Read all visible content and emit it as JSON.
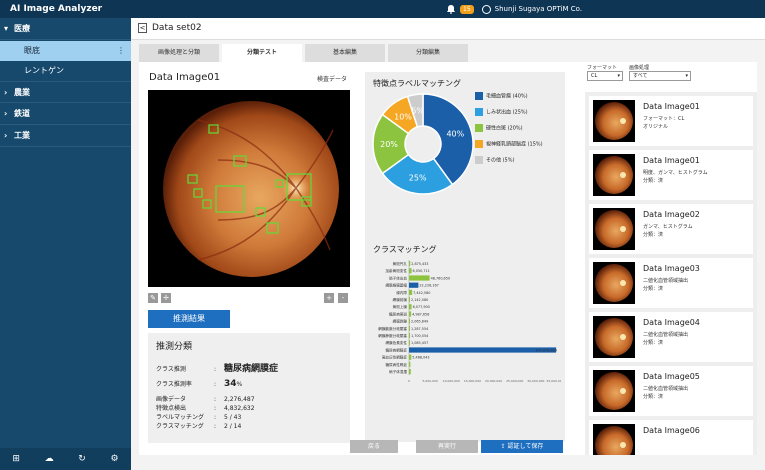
{
  "app": {
    "title": "AI Image Analyzer",
    "notification_count": "15",
    "user": "Shunji Sugaya OPTiM Co."
  },
  "sidebar": {
    "categories": [
      {
        "label": "医療",
        "expanded": true,
        "items": [
          {
            "label": "眼底",
            "active": true
          },
          {
            "label": "レントゲン",
            "active": false
          }
        ]
      },
      {
        "label": "農業",
        "expanded": false
      },
      {
        "label": "鉄道",
        "expanded": false
      },
      {
        "label": "工業",
        "expanded": false
      }
    ],
    "kebab": "⋮"
  },
  "header": {
    "back": "<",
    "dataset": "Data set02"
  },
  "tabs": [
    {
      "label": "画像処理と分類",
      "active": false
    },
    {
      "label": "分類テスト",
      "active": true
    },
    {
      "label": "基本編集",
      "active": false
    },
    {
      "label": "分類編集",
      "active": false
    }
  ],
  "image_panel": {
    "title": "Data Image01",
    "inspect_link": "検査データ",
    "result_button": "推測結果",
    "plus": "+",
    "minus": "-"
  },
  "inference": {
    "title": "推測分類",
    "rows": [
      {
        "k": "クラス推測",
        "v": "糖尿病網膜症"
      },
      {
        "k": "クラス推測率",
        "v": "34",
        "unit": "%"
      },
      {
        "k": "画像データ",
        "v": "2,276,487"
      },
      {
        "k": "特徴点検出",
        "v": "4,832,632"
      },
      {
        "k": "ラベルマッチング",
        "v": "5 / 43"
      },
      {
        "k": "クラスマッチング",
        "v": "2 / 14"
      }
    ]
  },
  "chart_titles": {
    "pie": "特徴点ラベルマッチング",
    "bar": "クラスマッチング"
  },
  "chart_data": [
    {
      "type": "pie",
      "title": "特徴点ラベルマッチング",
      "legend_position": "right",
      "categories": [
        "毛細血管瘤 (40%)",
        "しみ状出血 (25%)",
        "硬性白斑 (20%)",
        "視神経乳頭部脳症 (15%)",
        "その他 (5%)"
      ],
      "labels": [
        "40%",
        "25%",
        "20%",
        "10%",
        "5%"
      ],
      "values": [
        40,
        25,
        20,
        10,
        5
      ],
      "colors": [
        "#1a5fa8",
        "#2b9fe0",
        "#8cc43f",
        "#f5a623",
        "#cccccc"
      ]
    },
    {
      "type": "bar",
      "title": "クラスマッチング",
      "orientation": "horizontal",
      "categories": [
        "黄斑円孔",
        "加齢黄斑変性",
        "硝子体出血",
        "網脈絡膜萎縮",
        "緑内障",
        "網膜前膜",
        "黄斑上膜",
        "糖尿病黄斑",
        "網膜剥離",
        "網膜動脈分岐閉塞",
        "網膜静脈分岐閉塞",
        "網膜色素変性",
        "糖尿病網膜症",
        "高血圧性網膜症",
        "糖尿病性腎症",
        "硝子体混濁"
      ],
      "values": [
        2875433,
        6050711,
        48760659,
        22226167,
        7442580,
        2142580,
        6077900,
        4987658,
        2065649,
        1287554,
        1700554,
        1085457,
        347876659,
        5468043,
        3210000,
        4200000
      ],
      "value_labels": [
        "2,875,433",
        "6,050,711",
        "48,760,659",
        "22,226,167",
        "7,442,580",
        "2,142,580",
        "6,077,900",
        "4,987,658",
        "2,065,649",
        "1,287,554",
        "1,700,554",
        "1,085,457",
        "347,876,659",
        "5,468,043",
        "",
        ""
      ],
      "highlight_index": [
        3,
        12
      ],
      "xlim": [
        0,
        350000000
      ],
      "xticks": [
        "0",
        "5,000,000",
        "10,000,000",
        "15,000,000",
        "20,000,000",
        "25,000,000",
        "30,000,000",
        "35,000,000"
      ],
      "colors": {
        "normal": "#8cc43f",
        "highlight": "#1a5fa8"
      }
    }
  ],
  "filters": {
    "format_label": "フォーマット",
    "format_value": "CL",
    "process_label": "画像処理",
    "process_value": "すべて"
  },
  "list": [
    {
      "name": "Data Image01",
      "l1": "フォーマット：CL",
      "l2": "オリジナル"
    },
    {
      "name": "Data Image01",
      "l1": "明度、ガンマ、ヒストグラム",
      "l2": "分類：済"
    },
    {
      "name": "Data Image02",
      "l1": "ガンマ、ヒストグラム",
      "l2": "分類：済"
    },
    {
      "name": "Data Image03",
      "l1": "二値化血管領域抽出",
      "l2": "分類：済"
    },
    {
      "name": "Data Image04",
      "l1": "二値化血管領域抽出",
      "l2": "分類：済"
    },
    {
      "name": "Data Image05",
      "l1": "二値化血管領域抽出",
      "l2": "分類：済"
    },
    {
      "name": "Data Image06",
      "l1": "",
      "l2": ""
    }
  ],
  "footer": {
    "back": "戻る",
    "rerun": "再実行",
    "approve": "認証して保存"
  },
  "colors": {
    "navy": "#0f3555",
    "sidebar": "#17496d",
    "accent": "#1f6fc0",
    "sidebar_active": "#9fd0ef"
  }
}
